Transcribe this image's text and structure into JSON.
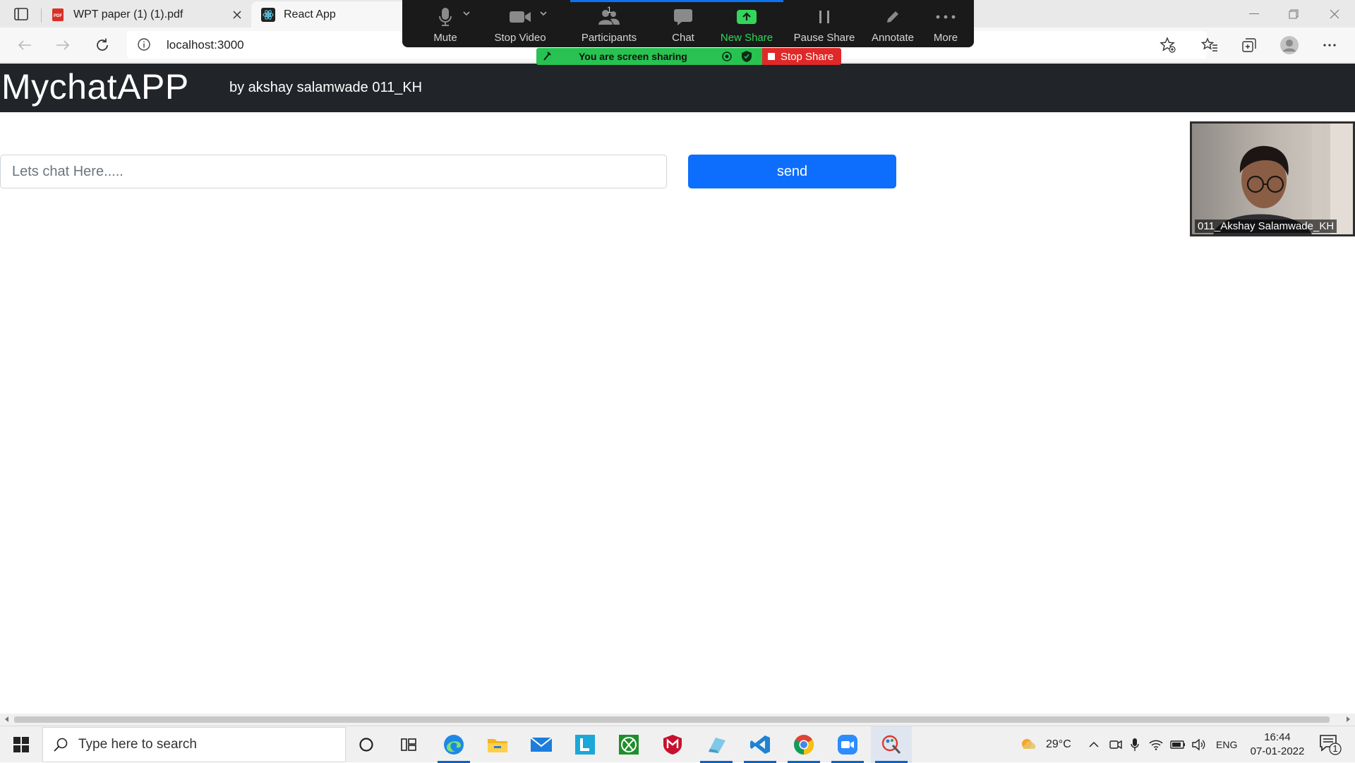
{
  "browser": {
    "tabs": [
      {
        "title": "WPT paper (1) (1).pdf",
        "icon": "pdf-icon",
        "active": false
      },
      {
        "title": "React App",
        "icon": "react-icon",
        "active": true
      }
    ],
    "url": "localhost:3000"
  },
  "zoom_toolbar": {
    "items": [
      {
        "label": "Mute",
        "icon": "microphone-icon"
      },
      {
        "label": "Stop Video",
        "icon": "video-camera-icon"
      },
      {
        "label": "Participants",
        "icon": "participants-icon",
        "count": "1"
      },
      {
        "label": "Chat",
        "icon": "chat-bubble-icon"
      },
      {
        "label": "New Share",
        "icon": "share-screen-icon"
      },
      {
        "label": "Pause Share",
        "icon": "pause-icon"
      },
      {
        "label": "Annotate",
        "icon": "pencil-icon"
      },
      {
        "label": "More",
        "icon": "ellipsis-icon"
      }
    ],
    "banner_text": "You are screen sharing",
    "stop_share_label": "Stop Share",
    "colors": {
      "bar": "#1a1a1a",
      "green": "#27c251",
      "red": "#e02828"
    }
  },
  "app": {
    "brand": "MychatAPP",
    "byline": "by akshay salamwade 011_KH",
    "input_placeholder": "Lets chat Here.....",
    "input_value": "",
    "send_label": "send",
    "colors": {
      "header": "#212529",
      "send_button": "#0d6efd"
    }
  },
  "video": {
    "participant_name": "011_Akshay Salamwade_KH"
  },
  "taskbar": {
    "search_placeholder": "Type here to search",
    "apps": [
      "cortana-icon",
      "task-view-icon",
      "edge-icon",
      "file-explorer-icon",
      "mail-icon",
      "l-app-icon",
      "xbox-icon",
      "mcafee-icon",
      "notepad-icon",
      "vscode-icon",
      "chrome-icon",
      "zoom-icon",
      "paint-icon"
    ],
    "weather": "29°C",
    "language": "ENG",
    "time": "16:44",
    "date": "07-01-2022",
    "notifications": "1"
  }
}
